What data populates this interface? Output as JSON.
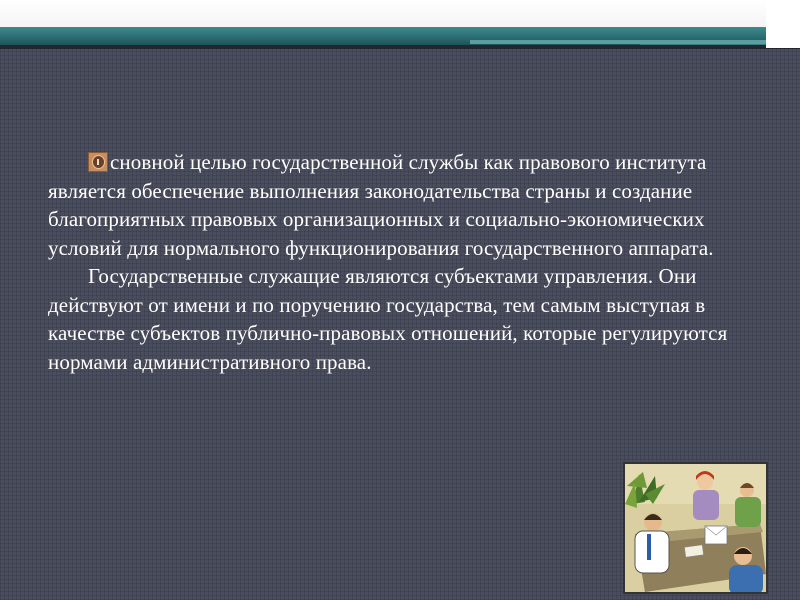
{
  "slide": {
    "paragraphs": [
      {
        "text": "сновной целью государственной службы как правового института является обеспечение выполнения законодательства страны и создание благоприятных правовых организационных и социально-экономических условий для нормального функционирования государственного аппарата."
      },
      {
        "text": "Государственные служащие являются субъектами управления. Они действуют от имени и по поручению государства, тем самым выступая в качестве субъектов публично-правовых отношений, которые регулируются нормами административного права."
      }
    ],
    "bullet_icon": "drop-cap-bullet-icon",
    "clipart_icon": "office-meeting-illustration"
  },
  "colors": {
    "background": "#4a4d5d",
    "top_band": "#2c6e73",
    "text": "#ffffff"
  }
}
